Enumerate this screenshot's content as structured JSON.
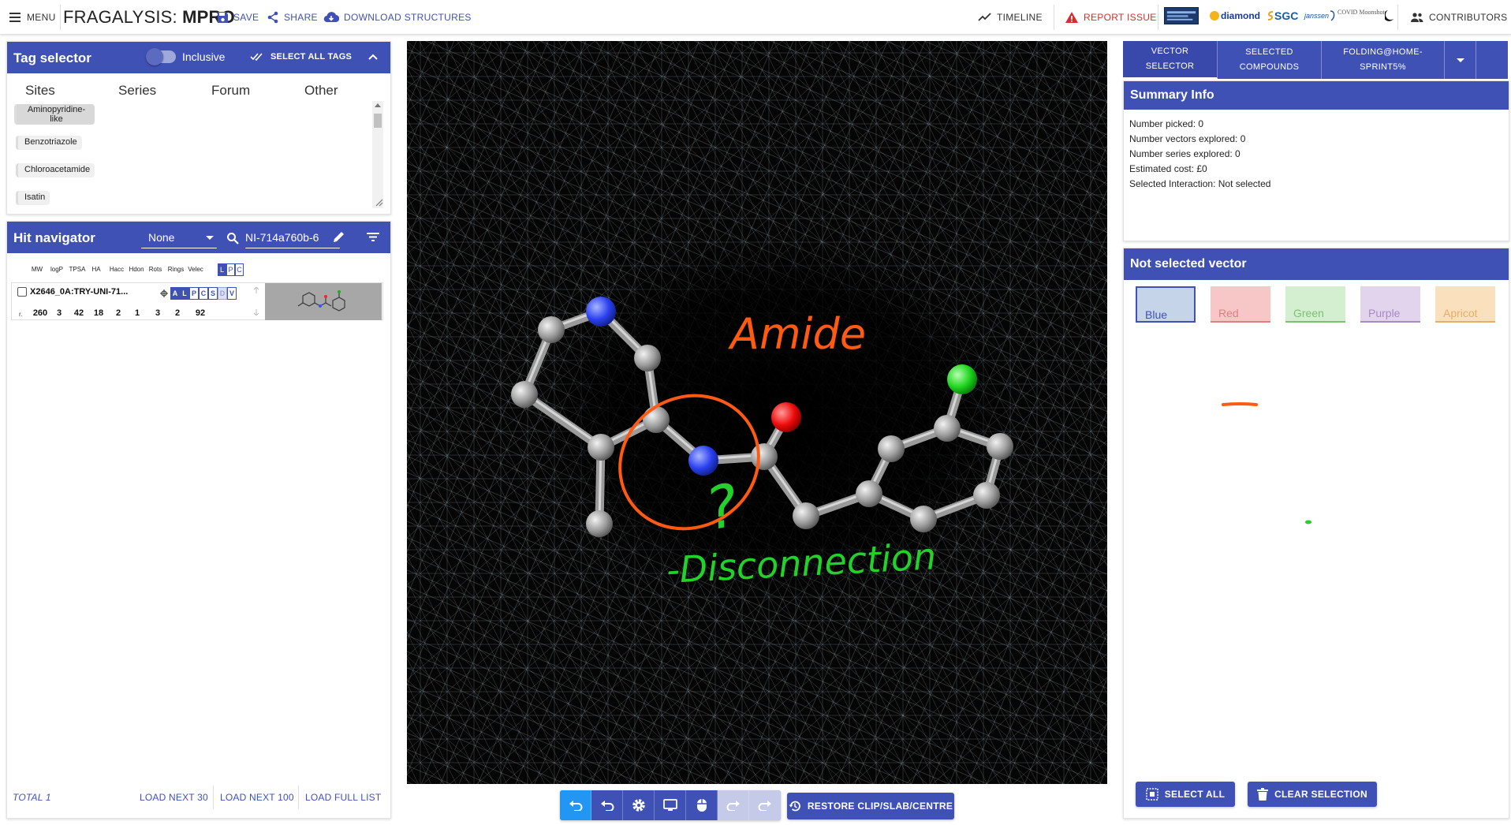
{
  "topbar": {
    "menu_label": "MENU",
    "brand_prefix": "FRAGALYSIS:",
    "brand_target": "MPRO",
    "save_label": "SAVE",
    "share_label": "SHARE",
    "download_label": "DOWNLOAD STRUCTURES",
    "timeline_label": "TIMELINE",
    "report_label": "REPORT ISSUE",
    "contributors_label": "CONTRIBUTORS",
    "logos": [
      "diamond",
      "SGC",
      "janssen",
      "COVID Moonshot"
    ]
  },
  "tag_selector": {
    "title": "Tag selector",
    "toggle_label": "Inclusive",
    "select_all_label": "SELECT ALL TAGS",
    "categories": [
      "Sites",
      "Series",
      "Forum",
      "Other"
    ],
    "tags": [
      "Aminopyridine-like",
      "Benzotriazole",
      "Chloroacetamide",
      "Isatin"
    ]
  },
  "hit_navigator": {
    "title": "Hit navigator",
    "filter_value": "None",
    "search_value": "NI-714a760b-6",
    "columns": [
      "MW",
      "logP",
      "TPSA",
      "HA",
      "Hacc",
      "Hdon",
      "Rots",
      "Rings",
      "Velec"
    ],
    "lpc": [
      "L",
      "P",
      "C"
    ],
    "hit": {
      "id": "X2646_0A:TRY-UNI-71...",
      "flags": [
        "A",
        "L",
        "P",
        "C",
        "S",
        "D",
        "V"
      ],
      "row_label": "r.",
      "values": [
        "260",
        "3",
        "42",
        "18",
        "2",
        "1",
        "3",
        "2",
        "92"
      ]
    },
    "total_label": "TOTAL 1",
    "load_next_30": "LOAD NEXT 30",
    "load_next_100": "LOAD NEXT 100",
    "load_full": "LOAD FULL LIST"
  },
  "viewer": {
    "annotation_amide": "Amide",
    "annotation_question": "?",
    "annotation_disconnection": "-Disconnection",
    "restore_label": "RESTORE CLIP/SLAB/CENTRE"
  },
  "right_panel": {
    "tabs": [
      "VECTOR SELECTOR",
      "SELECTED COMPOUNDS",
      "FOLDING@HOME-SPRINT5%"
    ],
    "summary_title": "Summary Info",
    "summary_lines": [
      "Number picked: 0",
      "Number vectors explored: 0",
      "Number series explored: 0",
      "Estimated cost: £0",
      "Selected Interaction: Not selected"
    ],
    "vector_title": "Not selected vector",
    "colors": [
      {
        "label": "Blue",
        "bg": "#c6d4ea",
        "line": "#3f51b5"
      },
      {
        "label": "Red",
        "bg": "#f7c6c6",
        "line": "#e08080"
      },
      {
        "label": "Green",
        "bg": "#d3efcf",
        "line": "#7fbf73"
      },
      {
        "label": "Purple",
        "bg": "#e3d4ee",
        "line": "#a78ac2"
      },
      {
        "label": "Apricot",
        "bg": "#fbe0bd",
        "line": "#e4b06a"
      }
    ],
    "select_all_label": "SELECT ALL",
    "clear_label": "CLEAR SELECTION"
  },
  "colors": {
    "primary": "#3f51b5",
    "accent_blue": "#2196f3",
    "report_red": "#d32f2f",
    "annotation_orange": "#ff5a12",
    "annotation_green": "#22d12a"
  }
}
